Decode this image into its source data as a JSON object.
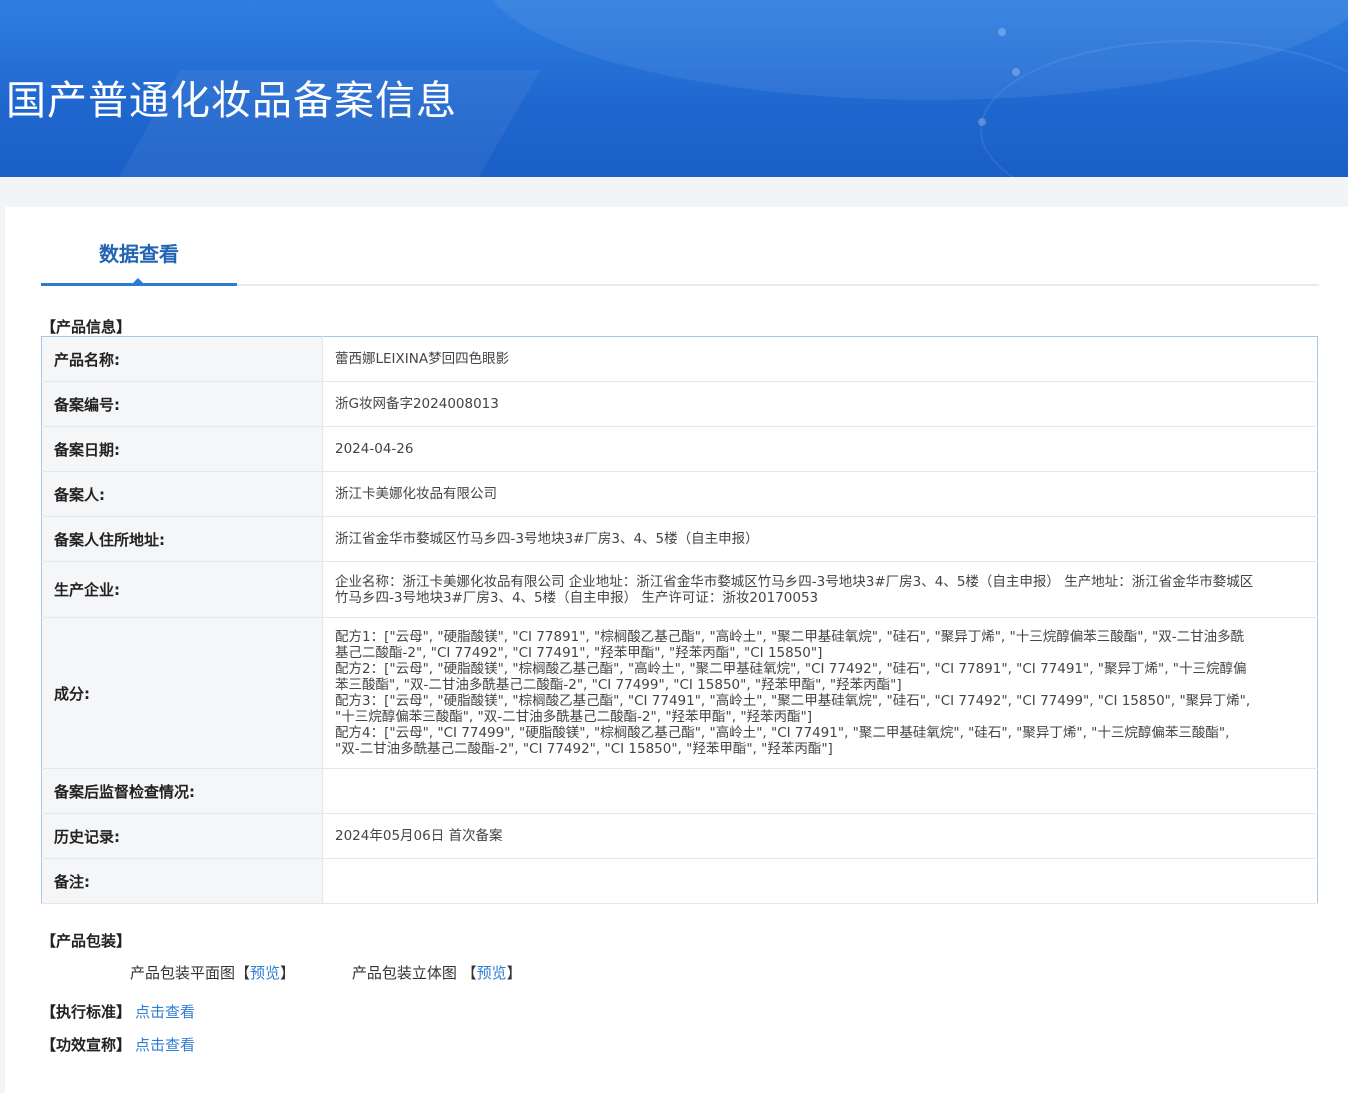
{
  "header": {
    "title": "国产普通化妆品备案信息"
  },
  "tabs": {
    "active": "数据查看"
  },
  "product_info": {
    "section_title": "【产品信息】",
    "rows": [
      {
        "label": "产品名称:",
        "value": "蕾西娜LEIXINA梦回四色眼影"
      },
      {
        "label": "备案编号:",
        "value": "浙G妆网备字2024008013"
      },
      {
        "label": "备案日期:",
        "value": "2024-04-26"
      },
      {
        "label": "备案人:",
        "value": "浙江卡美娜化妆品有限公司"
      },
      {
        "label": "备案人住所地址:",
        "value": "浙江省金华市婺城区竹马乡四-3号地块3#厂房3、4、5楼（自主申报）"
      },
      {
        "label": "生产企业:",
        "value": "企业名称：浙江卡美娜化妆品有限公司 企业地址：浙江省金华市婺城区竹马乡四-3号地块3#厂房3、4、5楼（自主申报） 生产地址：浙江省金华市婺城区竹马乡四-3号地块3#厂房3、4、5楼（自主申报） 生产许可证：浙妆20170053"
      },
      {
        "label": "成分:",
        "formulas": [
          "配方1：[\"云母\", \"硬脂酸镁\", \"CI 77891\", \"棕榈酸乙基己酯\", \"高岭土\", \"聚二甲基硅氧烷\", \"硅石\", \"聚异丁烯\", \"十三烷醇偏苯三酸酯\", \"双-二甘油多酰基己二酸酯-2\", \"CI 77492\", \"CI 77491\", \"羟苯甲酯\", \"羟苯丙酯\", \"CI 15850\"]",
          "配方2：[\"云母\", \"硬脂酸镁\", \"棕榈酸乙基己酯\", \"高岭土\", \"聚二甲基硅氧烷\", \"CI 77492\", \"硅石\", \"CI 77891\", \"CI 77491\", \"聚异丁烯\", \"十三烷醇偏苯三酸酯\", \"双-二甘油多酰基己二酸酯-2\", \"CI 77499\", \"CI 15850\", \"羟苯甲酯\", \"羟苯丙酯\"]",
          "配方3：[\"云母\", \"硬脂酸镁\", \"棕榈酸乙基己酯\", \"CI 77491\", \"高岭土\", \"聚二甲基硅氧烷\", \"硅石\", \"CI 77492\", \"CI 77499\", \"CI 15850\", \"聚异丁烯\", \"十三烷醇偏苯三酸酯\", \"双-二甘油多酰基己二酸酯-2\", \"羟苯甲酯\", \"羟苯丙酯\"]",
          "配方4：[\"云母\", \"CI 77499\", \"硬脂酸镁\", \"棕榈酸乙基己酯\", \"高岭土\", \"CI 77491\", \"聚二甲基硅氧烷\", \"硅石\", \"聚异丁烯\", \"十三烷醇偏苯三酸酯\", \"双-二甘油多酰基己二酸酯-2\", \"CI 77492\", \"CI 15850\", \"羟苯甲酯\", \"羟苯丙酯\"]"
        ]
      },
      {
        "label": "备案后监督检查情况:",
        "value": ""
      },
      {
        "label": "历史记录:",
        "value": "2024年05月06日 首次备案"
      },
      {
        "label": "备注:",
        "value": ""
      }
    ]
  },
  "packaging": {
    "section_title": "【产品包装】",
    "flat_label": "产品包装平面图",
    "flat_bracket_open": "【",
    "flat_link": "预览",
    "flat_bracket_close": "】",
    "stereo_label": "产品包装立体图",
    "stereo_bracket_open": "【",
    "stereo_link": "预览",
    "stereo_bracket_close": "】"
  },
  "standard": {
    "label": "【执行标准】",
    "link": "点击查看"
  },
  "efficacy": {
    "label": "【功效宣称】",
    "link": "点击查看"
  }
}
